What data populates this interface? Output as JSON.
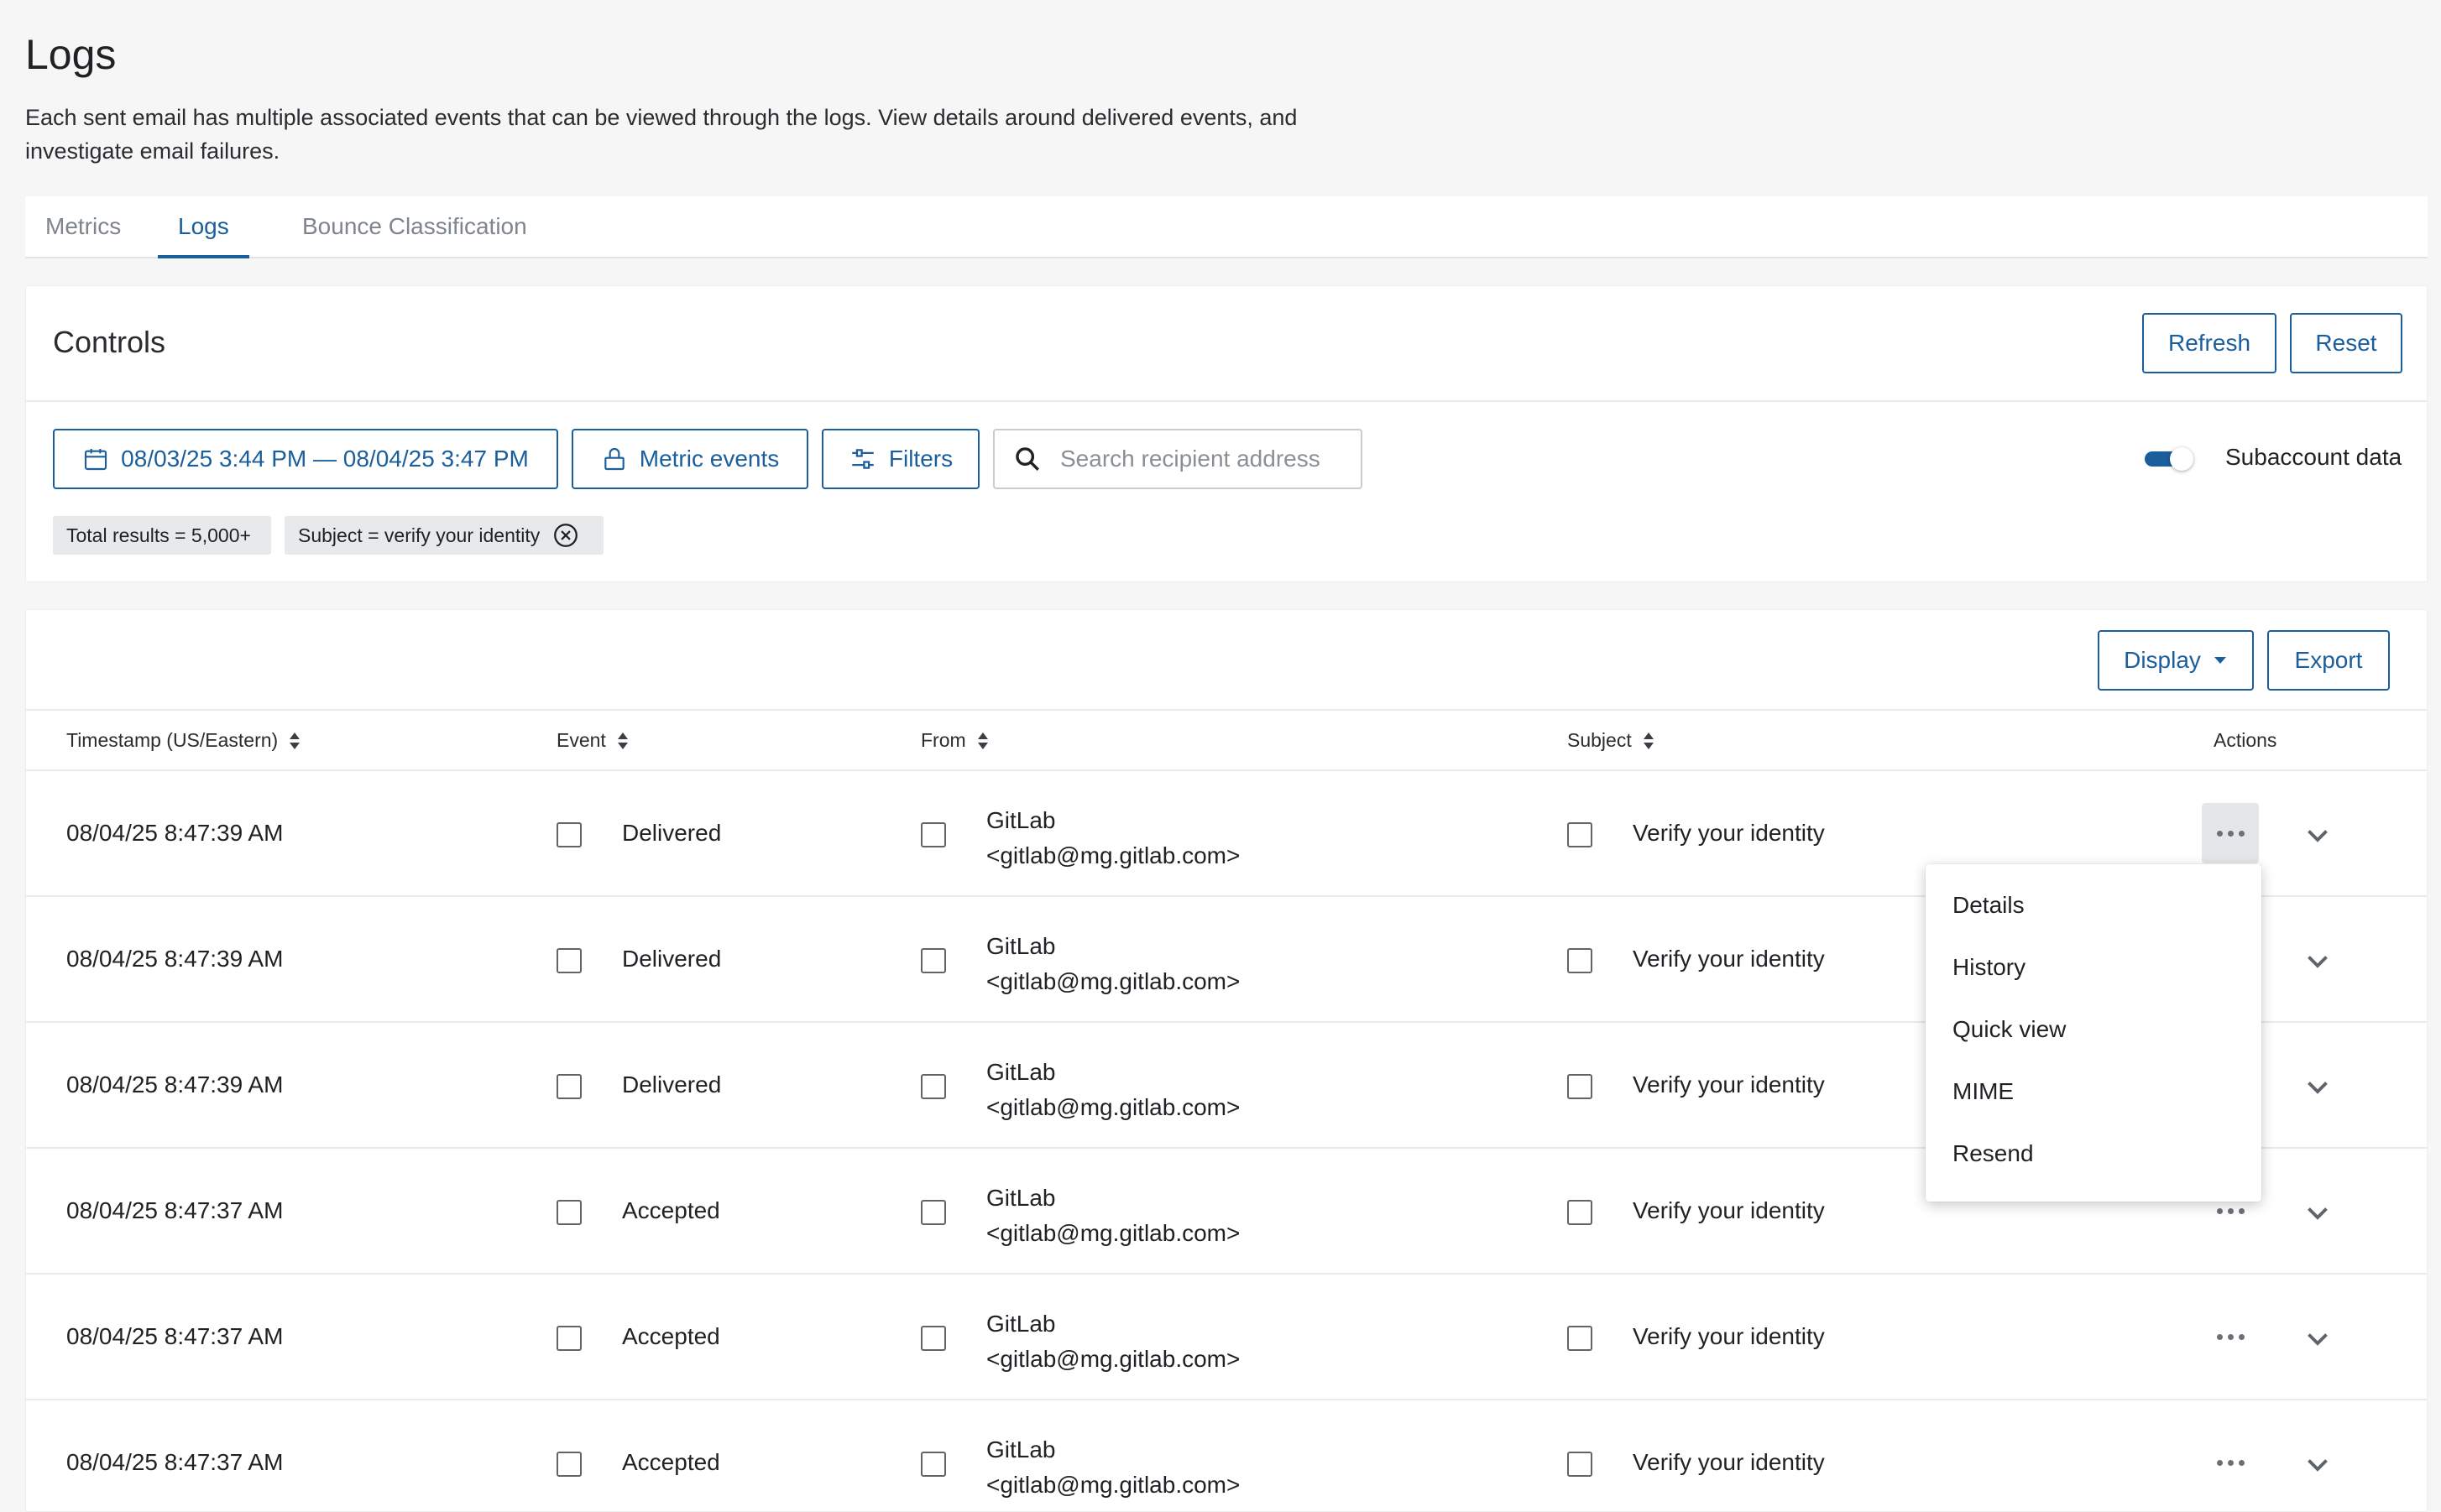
{
  "page": {
    "title": "Logs",
    "description": "Each sent email has multiple associated events that can be viewed through the logs. View details around delivered events, and investigate email failures."
  },
  "tabs": [
    {
      "label": "Metrics",
      "active": false
    },
    {
      "label": "Logs",
      "active": true
    },
    {
      "label": "Bounce Classification",
      "active": false
    }
  ],
  "controls": {
    "title": "Controls",
    "refresh_label": "Refresh",
    "reset_label": "Reset",
    "date_range_label": "08/03/25 3:44 PM — 08/04/25 3:47 PM",
    "metric_events_label": "Metric events",
    "filters_label": "Filters",
    "search_placeholder": "Search recipient address",
    "search_value": "",
    "subaccount_label": "Subaccount data",
    "subaccount_enabled": true,
    "chips": [
      {
        "label": "Total results = 5,000+",
        "removable": false
      },
      {
        "label": "Subject = verify your identity",
        "removable": true
      }
    ]
  },
  "table": {
    "display_label": "Display",
    "export_label": "Export",
    "columns": {
      "timestamp": "Timestamp (US/Eastern)",
      "event": "Event",
      "from": "From",
      "subject": "Subject",
      "actions": "Actions"
    },
    "rows": [
      {
        "timestamp": "08/04/25 8:47:39 AM",
        "event": "Delivered",
        "from_name": "GitLab",
        "from_email": "<gitlab@mg.gitlab.com>",
        "subject": "Verify your identity"
      },
      {
        "timestamp": "08/04/25 8:47:39 AM",
        "event": "Delivered",
        "from_name": "GitLab",
        "from_email": "<gitlab@mg.gitlab.com>",
        "subject": "Verify your identity"
      },
      {
        "timestamp": "08/04/25 8:47:39 AM",
        "event": "Delivered",
        "from_name": "GitLab",
        "from_email": "<gitlab@mg.gitlab.com>",
        "subject": "Verify your identity"
      },
      {
        "timestamp": "08/04/25 8:47:37 AM",
        "event": "Accepted",
        "from_name": "GitLab",
        "from_email": "<gitlab@mg.gitlab.com>",
        "subject": "Verify your identity"
      },
      {
        "timestamp": "08/04/25 8:47:37 AM",
        "event": "Accepted",
        "from_name": "GitLab",
        "from_email": "<gitlab@mg.gitlab.com>",
        "subject": "Verify your identity"
      },
      {
        "timestamp": "08/04/25 8:47:37 AM",
        "event": "Accepted",
        "from_name": "GitLab",
        "from_email": "<gitlab@mg.gitlab.com>",
        "subject": "Verify your identity"
      }
    ]
  },
  "actions_menu": {
    "items": [
      "Details",
      "History",
      "Quick view",
      "MIME",
      "Resend"
    ]
  },
  "colors": {
    "accent": "#1b5e9c",
    "background": "#f6f6f7",
    "chip": "#e8e9eb"
  }
}
